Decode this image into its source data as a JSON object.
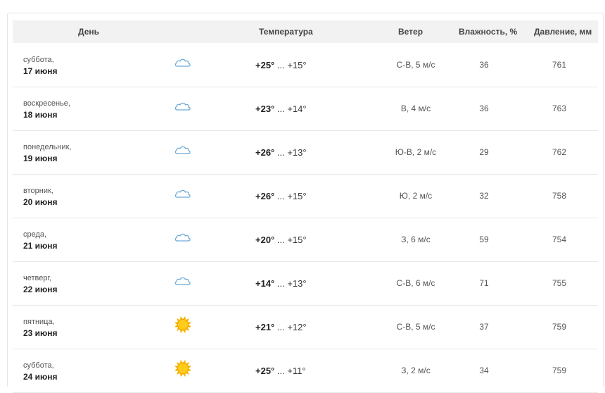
{
  "headers": {
    "day": "День",
    "temperature": "Температура",
    "wind": "Ветер",
    "humidity": "Влажность, %",
    "pressure": "Давление, мм"
  },
  "rows": [
    {
      "dayname": "суббота,",
      "date": "17 июня",
      "icon": "cloud-icon",
      "hi": "+25°",
      "lo": " ... +15°",
      "wind": "С-В, 5 м/с",
      "humidity": "36",
      "pressure": "761"
    },
    {
      "dayname": "воскресенье,",
      "date": "18 июня",
      "icon": "cloud-icon",
      "hi": "+23°",
      "lo": " ... +14°",
      "wind": "В, 4 м/с",
      "humidity": "36",
      "pressure": "763"
    },
    {
      "dayname": "понедельник,",
      "date": "19 июня",
      "icon": "cloud-icon",
      "hi": "+26°",
      "lo": " ... +13°",
      "wind": "Ю-В, 2 м/с",
      "humidity": "29",
      "pressure": "762"
    },
    {
      "dayname": "вторник,",
      "date": "20 июня",
      "icon": "cloud-icon",
      "hi": "+26°",
      "lo": " ... +15°",
      "wind": "Ю, 2 м/с",
      "humidity": "32",
      "pressure": "758"
    },
    {
      "dayname": "среда,",
      "date": "21 июня",
      "icon": "cloud-icon",
      "hi": "+20°",
      "lo": " ... +15°",
      "wind": "З, 6 м/с",
      "humidity": "59",
      "pressure": "754"
    },
    {
      "dayname": "четверг,",
      "date": "22 июня",
      "icon": "cloud-icon",
      "hi": "+14°",
      "lo": " ... +13°",
      "wind": "С-В, 6 м/с",
      "humidity": "71",
      "pressure": "755"
    },
    {
      "dayname": "пятница,",
      "date": "23 июня",
      "icon": "sun-icon",
      "hi": "+21°",
      "lo": " ... +12°",
      "wind": "С-В, 5 м/с",
      "humidity": "37",
      "pressure": "759"
    },
    {
      "dayname": "суббота,",
      "date": "24 июня",
      "icon": "sun-icon",
      "hi": "+25°",
      "lo": " ... +11°",
      "wind": "З, 2 м/с",
      "humidity": "34",
      "pressure": "759"
    }
  ],
  "colors": {
    "header_bg": "#f2f2f2",
    "border": "#e9e9e9",
    "sun": "#f5b400",
    "cloud_stroke": "#6aa9d6"
  }
}
